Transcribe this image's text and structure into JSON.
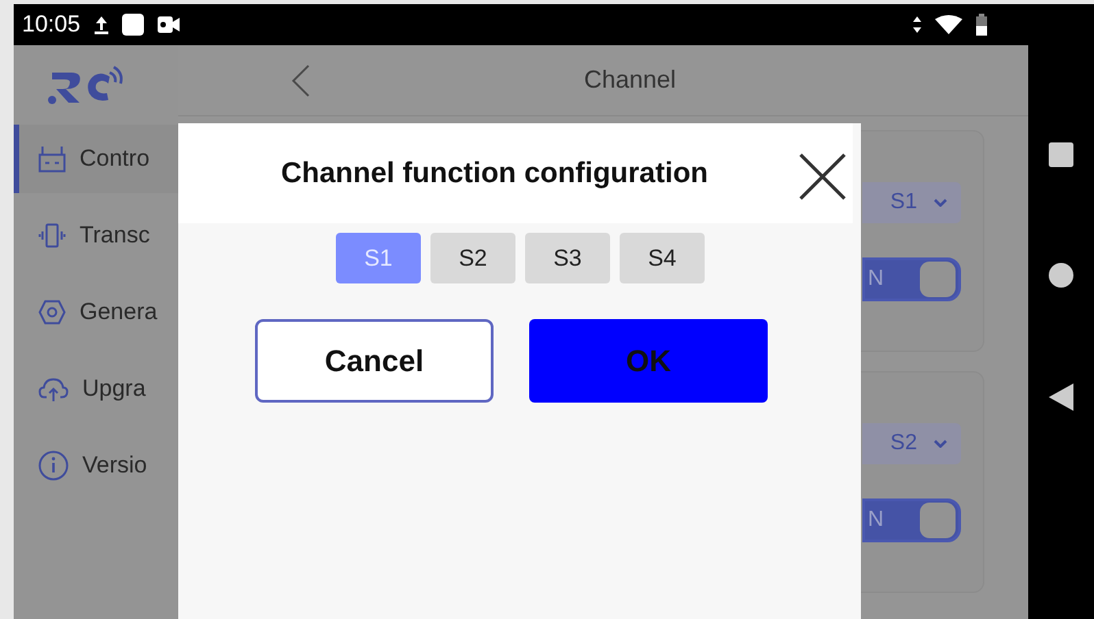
{
  "status_bar": {
    "time": "10:05"
  },
  "sidebar": {
    "items": [
      {
        "label": "Contro",
        "selected": true
      },
      {
        "label": "Transc",
        "selected": false
      },
      {
        "label": "Genera",
        "selected": false
      },
      {
        "label": "Upgra",
        "selected": false
      },
      {
        "label": "Versio",
        "selected": false
      }
    ]
  },
  "header": {
    "title": "Channel"
  },
  "channels": [
    {
      "value": "S1",
      "switch_text": "N",
      "on": true
    },
    {
      "value": "S2",
      "switch_text": "N",
      "on": true
    }
  ],
  "dialog": {
    "title": "Channel function configuration",
    "tabs": [
      {
        "label": "S1",
        "selected": true
      },
      {
        "label": "S2",
        "selected": false
      },
      {
        "label": "S3",
        "selected": false
      },
      {
        "label": "S4",
        "selected": false
      }
    ],
    "buttons": [
      {
        "label": "Cancel",
        "kind": "secondary"
      },
      {
        "label": "OK",
        "kind": "primary"
      }
    ]
  }
}
